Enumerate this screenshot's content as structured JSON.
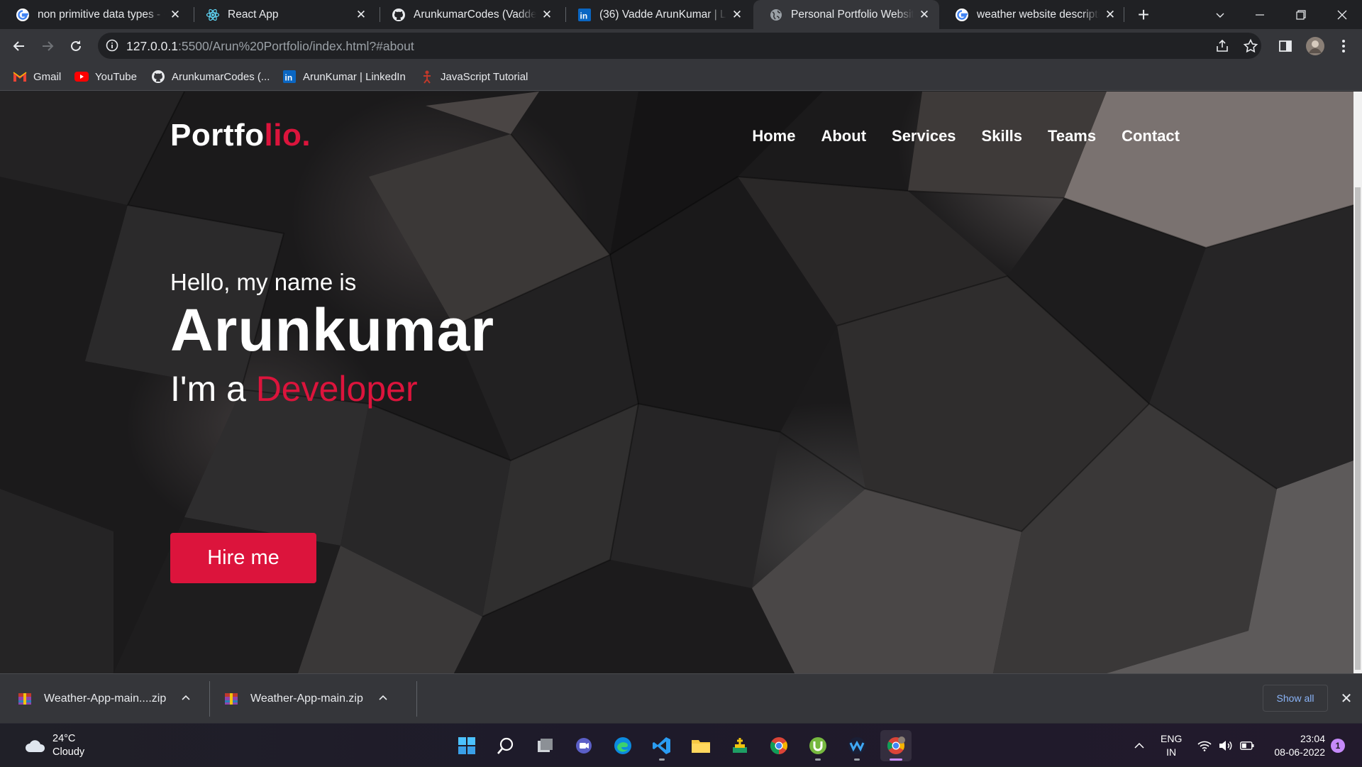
{
  "browser": {
    "tabs": [
      {
        "title": "non primitive data types - Google Search",
        "icon": "google-icon",
        "active": false
      },
      {
        "title": "React App",
        "icon": "react-icon",
        "active": false
      },
      {
        "title": "ArunkumarCodes (Vadde ArunKumar)",
        "icon": "github-icon",
        "active": false
      },
      {
        "title": "(36) Vadde ArunKumar | LinkedIn",
        "icon": "linkedin-icon",
        "active": false
      },
      {
        "title": "Personal Portfolio Website",
        "icon": "globe-icon",
        "active": true
      },
      {
        "title": "weather website description - Google Search",
        "icon": "google-icon",
        "active": false
      }
    ],
    "url_host": "127.0.0.1",
    "url_rest": ":5500/Arun%20Portfolio/index.html?#about",
    "bookmarks": [
      {
        "label": "Gmail",
        "icon": "gmail-icon"
      },
      {
        "label": "YouTube",
        "icon": "youtube-icon"
      },
      {
        "label": "ArunkumarCodes (...",
        "icon": "github-icon"
      },
      {
        "label": "ArunKumar | LinkedIn",
        "icon": "linkedin-icon"
      },
      {
        "label": "JavaScript Tutorial",
        "icon": "js-tutorial-icon"
      }
    ]
  },
  "site": {
    "logo_main": "Portfo",
    "logo_accent": "lio.",
    "nav": [
      "Home",
      "About",
      "Services",
      "Skills",
      "Teams",
      "Contact"
    ],
    "hero": {
      "greeting": "Hello, my name is",
      "name": "Arunkumar",
      "role_prefix": "I'm a",
      "role_accent": "Developer",
      "cta": "Hire me"
    },
    "accent_color": "#dc143c"
  },
  "downloads": {
    "items": [
      "Weather-App-main....zip",
      "Weather-App-main.zip"
    ],
    "show_all": "Show all"
  },
  "taskbar": {
    "weather_temp": "24°C",
    "weather_desc": "Cloudy",
    "lang_1": "ENG",
    "lang_2": "IN",
    "time": "23:04",
    "date": "08-06-2022",
    "notifications": "1",
    "apps": [
      "windows-start-icon",
      "search-icon",
      "task-view-icon",
      "teams-chat-icon",
      "edge-icon",
      "vscode-icon",
      "file-explorer-icon",
      "app-icon",
      "chrome-icon",
      "utorrent-icon",
      "webex-icon",
      "chrome-profile-icon"
    ]
  }
}
